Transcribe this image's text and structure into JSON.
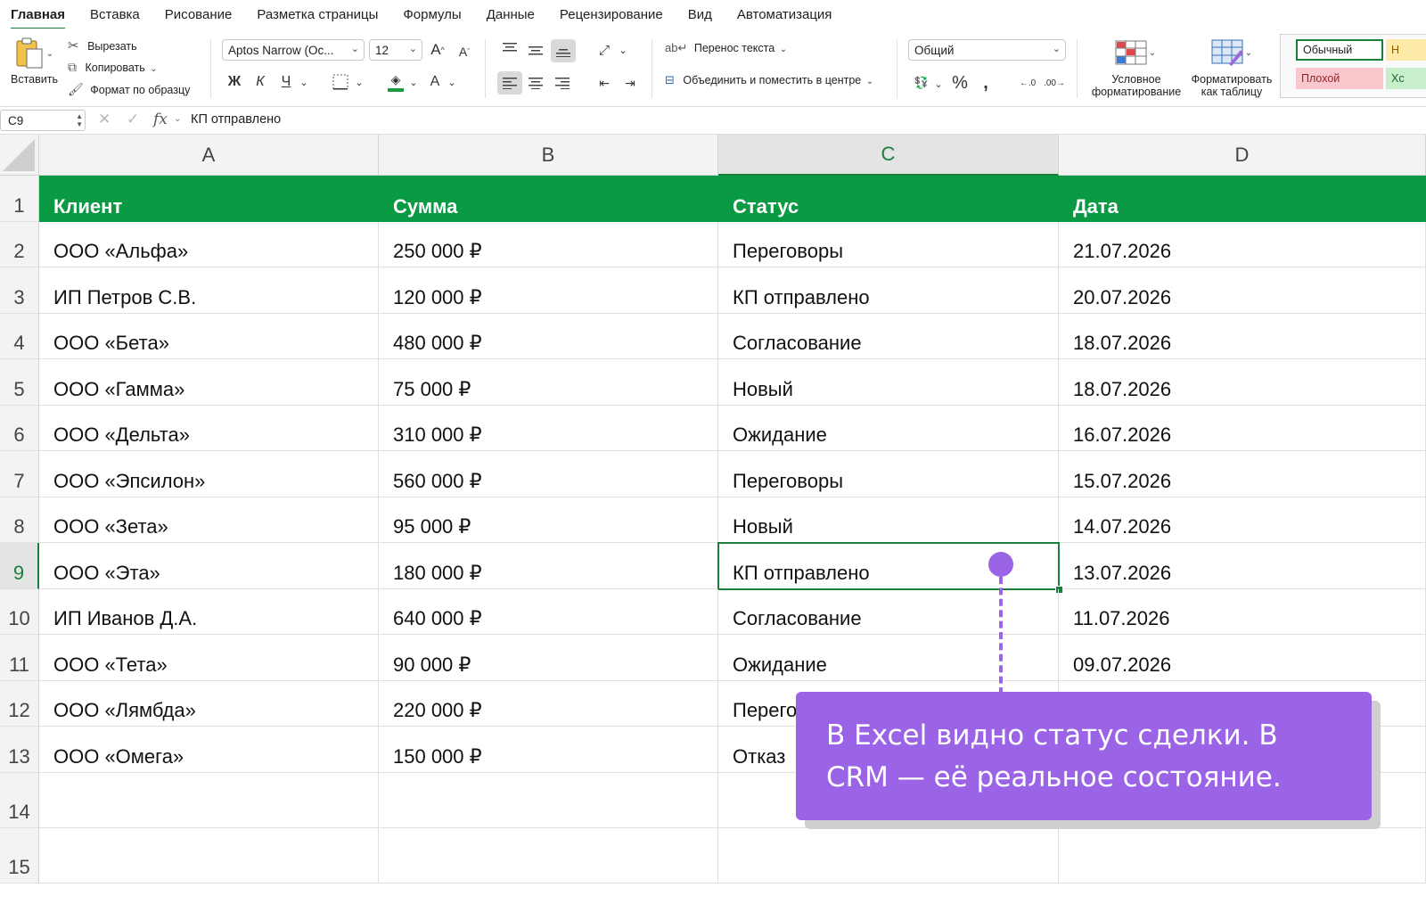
{
  "tabs": [
    "Главная",
    "Вставка",
    "Рисование",
    "Разметка страницы",
    "Формулы",
    "Данные",
    "Рецензирование",
    "Вид",
    "Автоматизация"
  ],
  "ribbon": {
    "paste_label": "Вставить",
    "cut_label": "Вырезать",
    "copy_label": "Копировать",
    "format_painter_label": "Формат по образцу",
    "font_name": "Aptos Narrow (Ос...",
    "font_size": "12",
    "bold": "Ж",
    "italic": "К",
    "underline": "Ч",
    "wrap_text_label": "Перенос текста",
    "merge_label": "Объединить и поместить в центре",
    "number_format": "Общий",
    "conditional_formatting_label": [
      "Условное",
      "форматирование"
    ],
    "format_as_table_label": [
      "Форматировать",
      "как таблицу"
    ],
    "styles": {
      "normal": "Обычный",
      "bad": "Плохой",
      "neutral_fragment": "Н",
      "good_fragment": "Хс"
    }
  },
  "formula_bar": {
    "name_box": "C9",
    "fx": "fx",
    "content": "КП отправлено"
  },
  "columns": [
    "A",
    "B",
    "C",
    "D"
  ],
  "rows_numbers": [
    "1",
    "2",
    "3",
    "4",
    "5",
    "6",
    "7",
    "8",
    "9",
    "10",
    "11",
    "12",
    "13",
    "14",
    "15"
  ],
  "table": {
    "headers": [
      "Клиент",
      "Сумма",
      "Статус",
      "Дата"
    ],
    "rows": [
      [
        "ООО «Альфа»",
        "250 000 ₽",
        "Переговоры",
        "21.07.2026"
      ],
      [
        "ИП Петров С.В.",
        "120 000 ₽",
        "КП отправлено",
        "20.07.2026"
      ],
      [
        "ООО «Бета»",
        "480 000 ₽",
        "Согласование",
        "18.07.2026"
      ],
      [
        "ООО «Гамма»",
        "75 000 ₽",
        "Новый",
        "18.07.2026"
      ],
      [
        "ООО «Дельта»",
        "310 000 ₽",
        "Ожидание",
        "16.07.2026"
      ],
      [
        "ООО «Эпсилон»",
        "560 000 ₽",
        "Переговоры",
        "15.07.2026"
      ],
      [
        "ООО «Зета»",
        "95 000 ₽",
        "Новый",
        "14.07.2026"
      ],
      [
        "ООО «Эта»",
        "180 000 ₽",
        "КП отправлено",
        "13.07.2026"
      ],
      [
        "ИП Иванов Д.А.",
        "640 000 ₽",
        "Согласование",
        "11.07.2026"
      ],
      [
        "ООО «Тета»",
        "90 000 ₽",
        "Ожидание",
        "09.07.2026"
      ],
      [
        "ООО «Лямбда»",
        "220 000 ₽",
        "Перего",
        "",
        ""
      ],
      [
        "ООО «Омега»",
        "150 000 ₽",
        "Отказ",
        ""
      ]
    ]
  },
  "selected_cell": "C9",
  "callout_text": "В Excel видно статус сделки. В CRM — её реальное состояние.",
  "colors": {
    "header_green": "#0a9a43",
    "accent_green": "#1a7f3c",
    "callout_purple": "#9b63e6"
  }
}
